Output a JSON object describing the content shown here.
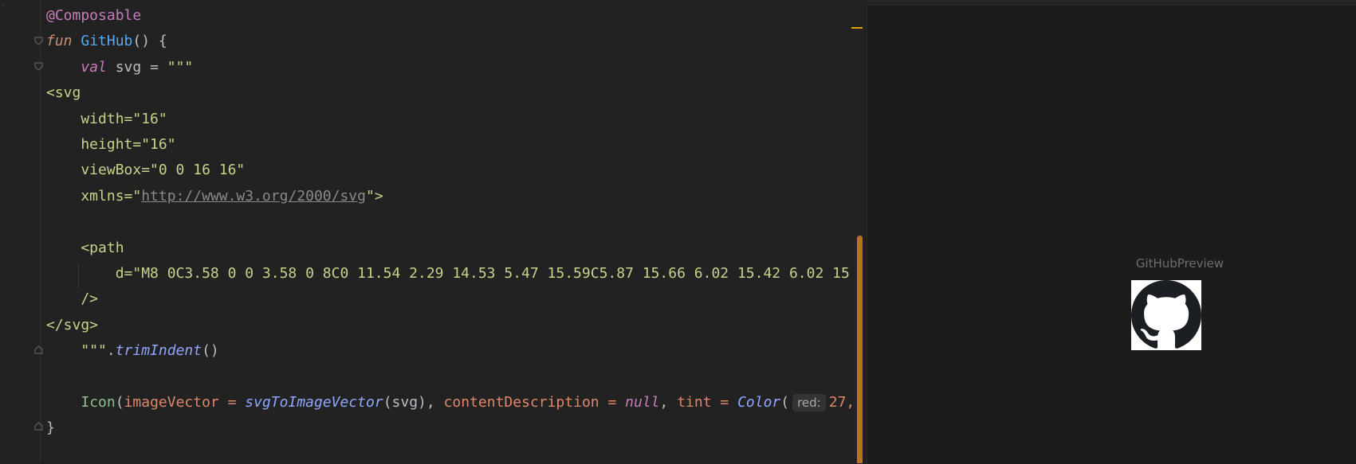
{
  "editor": {
    "lines": [
      {
        "id": "l1",
        "tokens": [
          {
            "c": "ann",
            "t": "@Composable"
          }
        ]
      },
      {
        "id": "l2",
        "tokens": [
          {
            "c": "kw",
            "t": "fun "
          },
          {
            "c": "fn",
            "t": "GitHub"
          },
          {
            "c": "punct",
            "t": "() {"
          }
        ]
      },
      {
        "id": "l3",
        "tokens": [
          {
            "c": "plain",
            "t": "    "
          },
          {
            "c": "kwv",
            "t": "val "
          },
          {
            "c": "plain",
            "t": "svg = "
          },
          {
            "c": "str",
            "t": "\"\"\""
          }
        ]
      },
      {
        "id": "l4",
        "tokens": [
          {
            "c": "str",
            "t": "<svg"
          }
        ]
      },
      {
        "id": "l5",
        "tokens": [
          {
            "c": "str",
            "t": "    width=\"16\""
          }
        ]
      },
      {
        "id": "l6",
        "tokens": [
          {
            "c": "str",
            "t": "    height=\"16\""
          }
        ]
      },
      {
        "id": "l7",
        "tokens": [
          {
            "c": "str",
            "t": "    viewBox=\"0 0 16 16\""
          }
        ]
      },
      {
        "id": "l8",
        "tokens": [
          {
            "c": "str",
            "t": "    xmlns=\""
          },
          {
            "c": "link",
            "t": "http://www.w3.org/2000/svg"
          },
          {
            "c": "str",
            "t": "\">"
          }
        ]
      },
      {
        "id": "l9",
        "tokens": []
      },
      {
        "id": "l10",
        "tokens": [
          {
            "c": "str",
            "t": "    <path"
          }
        ]
      },
      {
        "id": "l11",
        "tokens": [
          {
            "c": "str",
            "t": "        d=\"M8 0C3.58 0 0 3.58 0 8C0 11.54 2.29 14.53 5.47 15.59C5.87 15.66 6.02 15.42 6.02 15"
          }
        ]
      },
      {
        "id": "l12",
        "tokens": [
          {
            "c": "str",
            "t": "    />"
          }
        ]
      },
      {
        "id": "l13",
        "tokens": [
          {
            "c": "str",
            "t": "</svg>"
          }
        ]
      },
      {
        "id": "l14",
        "tokens": [
          {
            "c": "plain",
            "t": "    "
          },
          {
            "c": "str",
            "t": "\"\"\""
          },
          {
            "c": "punct",
            "t": "."
          },
          {
            "c": "ital",
            "t": "trimIndent"
          },
          {
            "c": "punct",
            "t": "()"
          }
        ]
      },
      {
        "id": "l15",
        "tokens": []
      },
      {
        "id": "l16",
        "tokens": [
          {
            "c": "plain",
            "t": "    "
          },
          {
            "c": "cls",
            "t": "Icon"
          },
          {
            "c": "punct",
            "t": "("
          },
          {
            "c": "named",
            "t": "imageVector"
          },
          {
            "c": "op",
            "t": " = "
          },
          {
            "c": "ital",
            "t": "svgToImageVector"
          },
          {
            "c": "punct",
            "t": "(svg), "
          },
          {
            "c": "named",
            "t": "contentDescription"
          },
          {
            "c": "op",
            "t": " = "
          },
          {
            "c": "nul",
            "t": "null"
          },
          {
            "c": "punct",
            "t": ", "
          },
          {
            "c": "named",
            "t": "tint"
          },
          {
            "c": "op",
            "t": " = "
          },
          {
            "c": "ital",
            "t": "Color"
          },
          {
            "c": "punct",
            "t": "("
          },
          {
            "c": "hint",
            "t": "red:"
          },
          {
            "c": "num",
            "t": "27,"
          }
        ]
      },
      {
        "id": "l17",
        "tokens": [
          {
            "c": "punct",
            "t": "}"
          }
        ]
      }
    ]
  },
  "preview": {
    "label": "GitHubPreview",
    "icon": "github-octocat-icon"
  },
  "colors": {
    "editor_bg": "#222222",
    "preview_bg": "#1c1c1c",
    "accent_orange": "#b8741a"
  }
}
